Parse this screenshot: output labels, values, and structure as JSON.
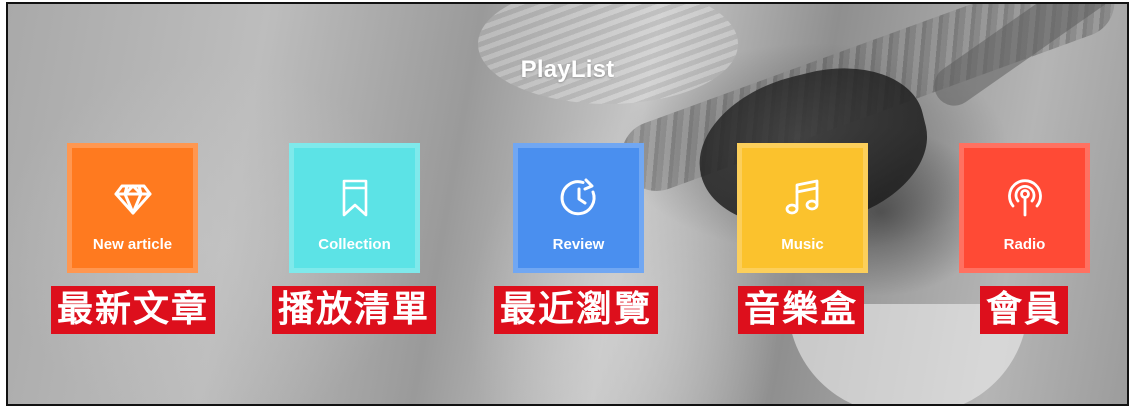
{
  "header": {
    "title": "PlayList"
  },
  "tiles": [
    {
      "label": "New article",
      "icon": "diamond-icon",
      "color": "#ff7a1f",
      "caption": "最新文章"
    },
    {
      "label": "Collection",
      "icon": "bookmark-icon",
      "color": "#5ce3e6",
      "caption": "播放清單"
    },
    {
      "label": "Review",
      "icon": "history-clock-icon",
      "color": "#4a8fef",
      "caption": "最近瀏覽"
    },
    {
      "label": "Music",
      "icon": "music-note-icon",
      "color": "#fbc22d",
      "caption": "音樂盒"
    },
    {
      "label": "Radio",
      "icon": "radio-broadcast-icon",
      "color": "#ff4a35",
      "caption": "會員"
    }
  ],
  "colors": {
    "caption_background": "#dd0f1c",
    "text": "#ffffff"
  }
}
